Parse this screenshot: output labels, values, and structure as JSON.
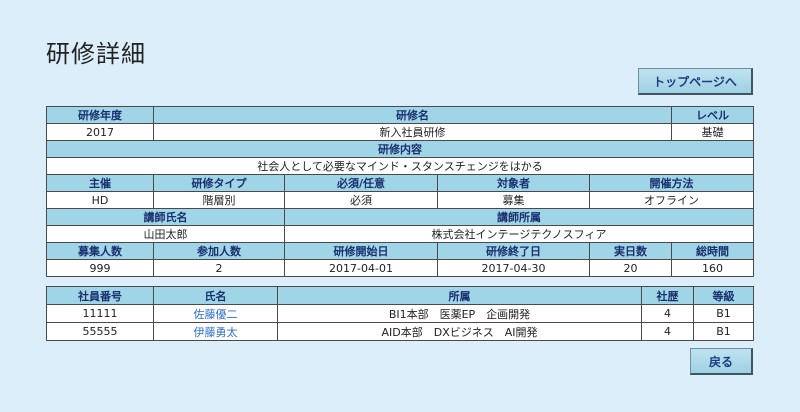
{
  "page": {
    "title": "研修詳細"
  },
  "buttons": {
    "top_page": "トップページへ",
    "back": "戻る"
  },
  "training": {
    "headers": {
      "year": "研修年度",
      "name": "研修名",
      "level": "レベル",
      "content": "研修内容",
      "organizer": "主催",
      "type": "研修タイプ",
      "required": "必須/任意",
      "target": "対象者",
      "method": "開催方法",
      "instructor": "講師氏名",
      "instructor_affiliation": "講師所属",
      "recruit_count": "募集人数",
      "participant_count": "参加人数",
      "start_date": "研修開始日",
      "end_date": "研修終了日",
      "actual_days": "実日数",
      "total_hours": "総時間"
    },
    "values": {
      "year": "2017",
      "name": "新入社員研修",
      "level": "基礎",
      "content": "社会人として必要なマインド・スタンスチェンジをはかる",
      "organizer": "HD",
      "type": "階層別",
      "required": "必須",
      "target": "募集",
      "method": "オフライン",
      "instructor": "山田太郎",
      "instructor_affiliation": "株式会社インテージテクノスフィア",
      "recruit_count": "999",
      "participant_count": "2",
      "start_date": "2017-04-01",
      "end_date": "2017-04-30",
      "actual_days": "20",
      "total_hours": "160"
    }
  },
  "participants": {
    "headers": {
      "employee_id": "社員番号",
      "name": "氏名",
      "department": "所属",
      "tenure": "社歴",
      "grade": "等級"
    },
    "rows": [
      {
        "employee_id": "11111",
        "name": "佐藤優二",
        "department": "BI1本部　医薬EP　企画開発",
        "tenure": "4",
        "grade": "B1"
      },
      {
        "employee_id": "55555",
        "name": "伊藤勇太",
        "department": "AID本部　DXビジネス　AI開発",
        "tenure": "4",
        "grade": "B1"
      }
    ]
  }
}
